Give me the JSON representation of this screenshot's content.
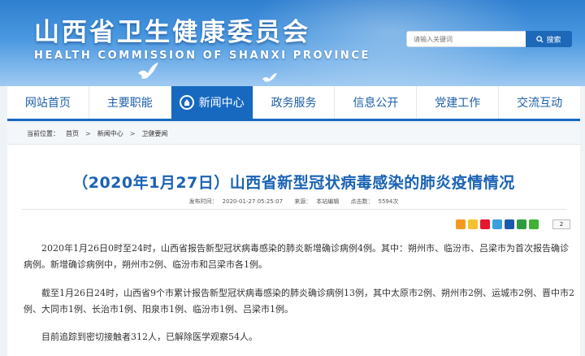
{
  "header": {
    "title": "山西省卫生健康委员会",
    "subtitle": "HEALTH COMMISSION OF SHANXI PROVINCE",
    "search_placeholder": "请输入关键词",
    "search_button": "搜索"
  },
  "nav": {
    "items": [
      "网站首页",
      "主要职能",
      "新闻中心",
      "政务服务",
      "信息公开",
      "党建工作",
      "交流互动"
    ],
    "active_index": 2
  },
  "breadcrumb": {
    "label": "当前位置：",
    "items": [
      "首页",
      "新闻中心",
      "卫健要闻"
    ],
    "separator": ">"
  },
  "article": {
    "title": "（2020年1月27日）山西省新型冠状病毒感染的肺炎疫情情况",
    "published_label": "发布时间：",
    "published_time": "2020-01-27 05:25:07",
    "source_label": "来源：",
    "source": "本站编辑",
    "clicks_label": "点击数：",
    "clicks": "5594次",
    "share_count": "2",
    "paragraphs": [
      "2020年1月26日0时至24时，山西省报告新型冠状病毒感染的肺炎新增确诊病例4例。其中：朔州市、临汾市、吕梁市为首次报告确诊病例。新增确诊病例中，朔州市2例、临汾市和吕梁市各1例。",
      "截至1月26日24时，山西省9个市累计报告新型冠状病毒感染的肺炎确诊病例13例，其中太原市2例、朔州市2例、运城市2例、晋中市2例、大同市1例、长治市1例、阳泉市1例、临汾市1例、吕梁市1例。",
      "目前追踪到密切接触者312人，已解除医学观察54人。"
    ]
  },
  "colors": {
    "primary": "#1769c0",
    "title_blue": "#1b63b4",
    "banner_top": "#2f7fd0"
  }
}
